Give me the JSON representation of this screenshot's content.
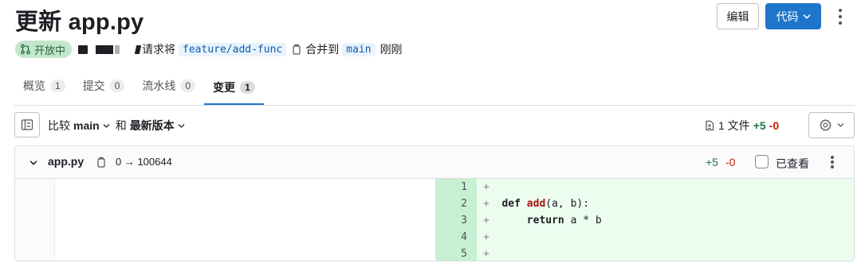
{
  "header": {
    "title": "更新 app.py",
    "edit_label": "编辑",
    "code_label": "代码"
  },
  "meta": {
    "status": "开放中",
    "request_text": "请求将",
    "source_branch": "feature/add-func",
    "merge_text": "合并到",
    "target_branch": "main",
    "time": "刚刚"
  },
  "tabs": [
    {
      "label": "概览",
      "count": "1"
    },
    {
      "label": "提交",
      "count": "0"
    },
    {
      "label": "流水线",
      "count": "0"
    },
    {
      "label": "变更",
      "count": "1"
    }
  ],
  "compare": {
    "prefix": "比较",
    "base": "main",
    "and": "和",
    "head": "最新版本"
  },
  "stats": {
    "files": "1 文件",
    "added": "+5",
    "removed": "-0"
  },
  "file": {
    "name": "app.py",
    "mode": "0 → 100644",
    "added": "+5",
    "removed": "-0",
    "viewed_label": "已查看",
    "lines": [
      {
        "num": "1",
        "text": ""
      },
      {
        "num": "2",
        "text": "def add(a, b):"
      },
      {
        "num": "3",
        "text": "    return a * b"
      },
      {
        "num": "4",
        "text": ""
      },
      {
        "num": "5",
        "text": ""
      }
    ]
  },
  "colors": {
    "primary": "#1f75cb",
    "addition": "#217645",
    "deletion": "#c91c00",
    "open_badge_bg": "#c3e6cd"
  },
  "icons": [
    "merge-request-icon",
    "chevron-down-icon",
    "kebab-icon",
    "copy-icon",
    "file-tree-icon",
    "file-diff-icon",
    "gear-icon"
  ]
}
